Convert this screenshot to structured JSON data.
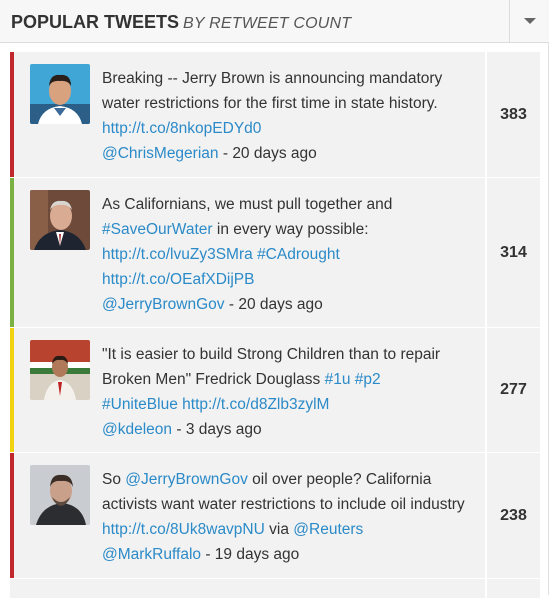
{
  "header": {
    "title": "POPULAR TWEETS",
    "subtitle": "BY RETWEET COUNT"
  },
  "tweets": [
    {
      "accent_color": "#c0282d",
      "text": "Breaking -- Jerry Brown is announcing mandatory water restrictions for the first time in state history.",
      "link": "http://t.co/8nkopEDYd0",
      "handle": "@ChrisMegerian",
      "time": "20 days ago",
      "count": "383"
    },
    {
      "accent_color": "#7bb142",
      "text_pre": "As Californians, we must pull together and",
      "hashtag1": "#SaveOurWater",
      "text_mid": "in every way possible:",
      "link1": "http://t.co/lvuZy3SMra",
      "hashtag2": "#CAdrought",
      "link2": "http://t.co/OEafXDijPB",
      "handle": "@JerryBrownGov",
      "time": "20 days ago",
      "count": "314"
    },
    {
      "accent_color": "#f2d311",
      "text": "\"It is easier to build Strong Children than to repair Broken Men\" Fredrick Douglass",
      "hashtag1": "#1u",
      "hashtag2": "#p2",
      "hashtag3": "#UniteBlue",
      "link": "http://t.co/d8Zlb3zylM",
      "handle": "@kdeleon",
      "time": "3 days ago",
      "count": "277"
    },
    {
      "accent_color": "#c0282d",
      "text_pre": "So",
      "mention1": "@JerryBrownGov",
      "text_mid": "oil over people? California activists want water restrictions to include oil industry",
      "link": "http://t.co/8Uk8wavpNU",
      "text_via": "via",
      "mention2": "@Reuters",
      "handle": "@MarkRuffalo",
      "time": "19 days ago",
      "count": "238"
    }
  ],
  "colors": {
    "link": "#2b8ac8",
    "row_bg": "#f2f2f2",
    "header_bg": "#f7f7f7"
  },
  "icons": {
    "menu": "chevron-down-icon"
  }
}
